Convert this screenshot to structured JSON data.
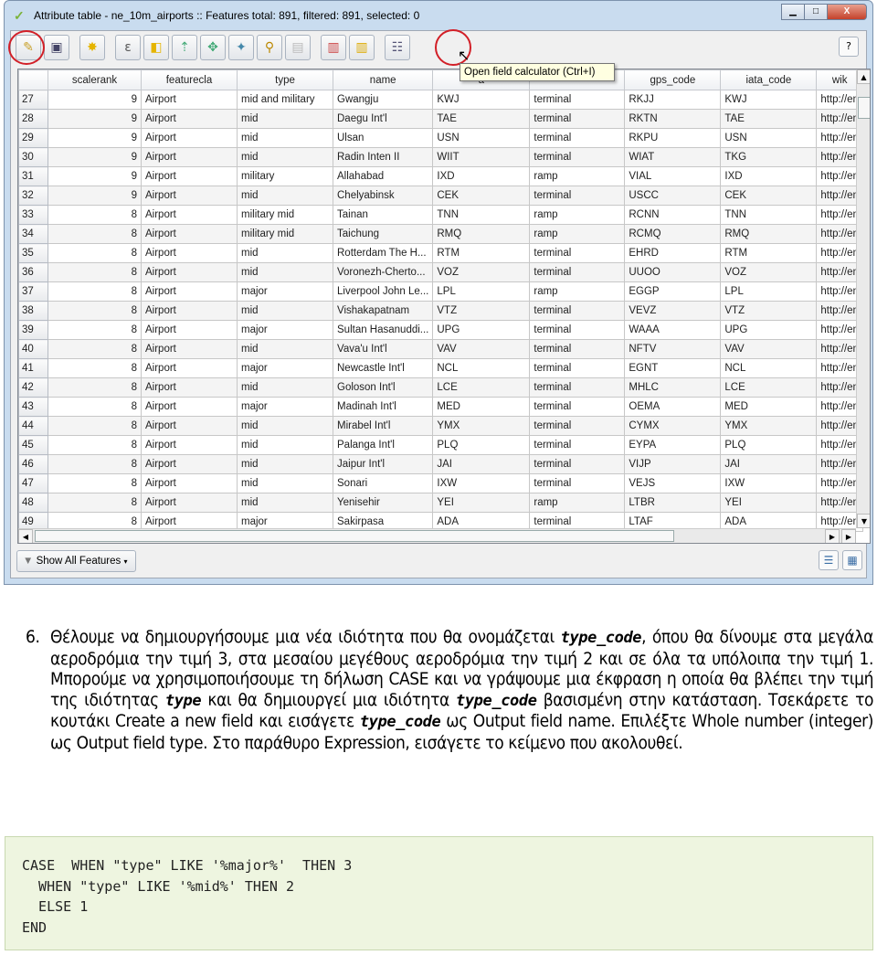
{
  "window": {
    "title": "Attribute table - ne_10m_airports :: Features total: 891, filtered: 891, selected: 0"
  },
  "toolbar": {
    "buttons": [
      "toggle-editing",
      "save-edits",
      "delete-selected",
      "select-by-expression",
      "invert-selection",
      "move-selection-to-top",
      "pan-to-selected",
      "zoom-to-selected",
      "copy-selected",
      "delete-column",
      "new-column",
      "open-field-calculator"
    ],
    "help_label": "?",
    "tooltip": "Open field calculator (Ctrl+I)",
    "highlight_color": "#d21f27"
  },
  "table": {
    "headers": [
      "scalerank",
      "featurecla",
      "type",
      "name",
      "a",
      "",
      "gps_code",
      "iata_code",
      "wik"
    ],
    "rows": [
      [
        "27",
        "9",
        "Airport",
        "mid and military",
        "Gwangju",
        "KWJ",
        "terminal",
        "RKJJ",
        "KWJ",
        "http://en"
      ],
      [
        "28",
        "9",
        "Airport",
        "mid",
        "Daegu Int'l",
        "TAE",
        "terminal",
        "RKTN",
        "TAE",
        "http://en"
      ],
      [
        "29",
        "9",
        "Airport",
        "mid",
        "Ulsan",
        "USN",
        "terminal",
        "RKPU",
        "USN",
        "http://en"
      ],
      [
        "30",
        "9",
        "Airport",
        "mid",
        "Radin Inten II",
        "WIIT",
        "terminal",
        "WIAT",
        "TKG",
        "http://en"
      ],
      [
        "31",
        "9",
        "Airport",
        "military",
        "Allahabad",
        "IXD",
        "ramp",
        "VIAL",
        "IXD",
        "http://en"
      ],
      [
        "32",
        "9",
        "Airport",
        "mid",
        "Chelyabinsk",
        "CEK",
        "terminal",
        "USCC",
        "CEK",
        "http://en"
      ],
      [
        "33",
        "8",
        "Airport",
        "military mid",
        "Tainan",
        "TNN",
        "ramp",
        "RCNN",
        "TNN",
        "http://en"
      ],
      [
        "34",
        "8",
        "Airport",
        "military mid",
        "Taichung",
        "RMQ",
        "ramp",
        "RCMQ",
        "RMQ",
        "http://en"
      ],
      [
        "35",
        "8",
        "Airport",
        "mid",
        "Rotterdam The H...",
        "RTM",
        "terminal",
        "EHRD",
        "RTM",
        "http://en"
      ],
      [
        "36",
        "8",
        "Airport",
        "mid",
        "Voronezh-Cherto...",
        "VOZ",
        "terminal",
        "UUOO",
        "VOZ",
        "http://en"
      ],
      [
        "37",
        "8",
        "Airport",
        "major",
        "Liverpool John Le...",
        "LPL",
        "ramp",
        "EGGP",
        "LPL",
        "http://en"
      ],
      [
        "38",
        "8",
        "Airport",
        "mid",
        "Vishakapatnam",
        "VTZ",
        "terminal",
        "VEVZ",
        "VTZ",
        "http://en"
      ],
      [
        "39",
        "8",
        "Airport",
        "major",
        "Sultan Hasanuddi...",
        "UPG",
        "terminal",
        "WAAA",
        "UPG",
        "http://en"
      ],
      [
        "40",
        "8",
        "Airport",
        "mid",
        "Vava'u Int'l",
        "VAV",
        "terminal",
        "NFTV",
        "VAV",
        "http://en"
      ],
      [
        "41",
        "8",
        "Airport",
        "major",
        "Newcastle Int'l",
        "NCL",
        "terminal",
        "EGNT",
        "NCL",
        "http://en"
      ],
      [
        "42",
        "8",
        "Airport",
        "mid",
        "Goloson Int'l",
        "LCE",
        "terminal",
        "MHLC",
        "LCE",
        "http://en"
      ],
      [
        "43",
        "8",
        "Airport",
        "major",
        "Madinah Int'l",
        "MED",
        "terminal",
        "OEMA",
        "MED",
        "http://en"
      ],
      [
        "44",
        "8",
        "Airport",
        "mid",
        "Mirabel Int'l",
        "YMX",
        "terminal",
        "CYMX",
        "YMX",
        "http://en"
      ],
      [
        "45",
        "8",
        "Airport",
        "mid",
        "Palanga Int'l",
        "PLQ",
        "terminal",
        "EYPA",
        "PLQ",
        "http://en"
      ],
      [
        "46",
        "8",
        "Airport",
        "mid",
        "Jaipur Int'l",
        "JAI",
        "terminal",
        "VIJP",
        "JAI",
        "http://en"
      ],
      [
        "47",
        "8",
        "Airport",
        "mid",
        "Sonari",
        "IXW",
        "terminal",
        "VEJS",
        "IXW",
        "http://en"
      ],
      [
        "48",
        "8",
        "Airport",
        "mid",
        "Yenisehir",
        "YEI",
        "ramp",
        "LTBR",
        "YEI",
        "http://en"
      ],
      [
        "49",
        "8",
        "Airport",
        "major",
        "Sakirpasa",
        "ADA",
        "terminal",
        "LTAF",
        "ADA",
        "http://en"
      ]
    ]
  },
  "bottom": {
    "show_all_label": "Show All Features"
  },
  "instructions": {
    "number": "6.",
    "segments": [
      {
        "text": "Θέλουμε να δημιουργήσουμε μια νέα ιδιότητα που θα ονομάζεται ",
        "code": false
      },
      {
        "text": "type_code",
        "code": true
      },
      {
        "text": ", όπου θα δίνουμε στα μεγάλα αεροδρόμια την τιμή 3, στα μεσαίου μεγέθους αεροδρόμια την τιμή 2 και σε όλα τα υπόλοιπα την τιμή 1. Μπορούμε να χρησιμοποιήσουμε τη δήλωση CASE και να γράψουμε μια έκφραση η οποία θα βλέπει την τιμή της ιδιότητας ",
        "code": false
      },
      {
        "text": "type",
        "code": true
      },
      {
        "text": " και θα δημιουργεί μια ιδιότητα ",
        "code": false
      },
      {
        "text": "type_code",
        "code": true
      },
      {
        "text": " βασισμένη στην κατάσταση. Τσεκάρετε το κουτάκι Create a new field και εισάγετε ",
        "code": false
      },
      {
        "text": "type_code",
        "code": true
      },
      {
        "text": " ως Output field name. Επιλέξτε Whole number (integer) ως Output field type. Στο παράθυρο Expression, εισάγετε το κείμενο που ακολουθεί.",
        "code": false
      }
    ]
  },
  "code": {
    "lines": [
      "CASE  WHEN \"type\" LIKE '%major%'  THEN 3",
      "  WHEN \"type\" LIKE '%mid%' THEN 2",
      "  ELSE 1",
      "END"
    ]
  }
}
